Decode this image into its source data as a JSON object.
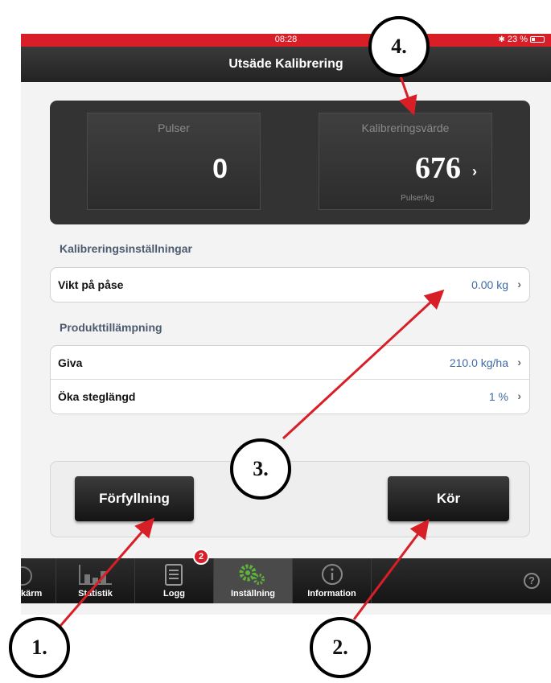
{
  "status_bar": {
    "time": "08:28",
    "battery": "23 %"
  },
  "nav": {
    "title": "Utsäde Kalibrering"
  },
  "dashboard": {
    "pulses": {
      "label": "Pulser",
      "value": "0"
    },
    "calibration": {
      "label": "Kalibreringsvärde",
      "value": "676",
      "unit": "Pulser/kg"
    }
  },
  "settings": {
    "heading": "Kalibreringsinställningar",
    "rows": [
      {
        "label": "Vikt på påse",
        "value": "0.00 kg"
      }
    ]
  },
  "application": {
    "heading": "Produkttillämpning",
    "rows": [
      {
        "label": "Giva",
        "value": "210.0 kg/ha"
      },
      {
        "label": "Öka steglängd",
        "value": "1 %"
      }
    ]
  },
  "actions": {
    "prefill_label": "Förfyllning",
    "run_label": "Kör"
  },
  "tabbar": {
    "tabs": [
      {
        "label": "kärm",
        "icon": "gauge-icon"
      },
      {
        "label": "Statistik",
        "icon": "bar-chart-icon"
      },
      {
        "label": "Logg",
        "icon": "log-icon"
      },
      {
        "label": "Inställning",
        "icon": "gears-icon"
      },
      {
        "label": "Information",
        "icon": "info-icon"
      }
    ],
    "badge": "2"
  },
  "annotations": {
    "c1": "1.",
    "c2": "2.",
    "c3": "3.",
    "c4": "4."
  },
  "colors": {
    "statusbar": "#d81f27",
    "value_blue": "#3f6aa6",
    "arrow": "#d81f27",
    "gear_green": "#5fb33b"
  }
}
